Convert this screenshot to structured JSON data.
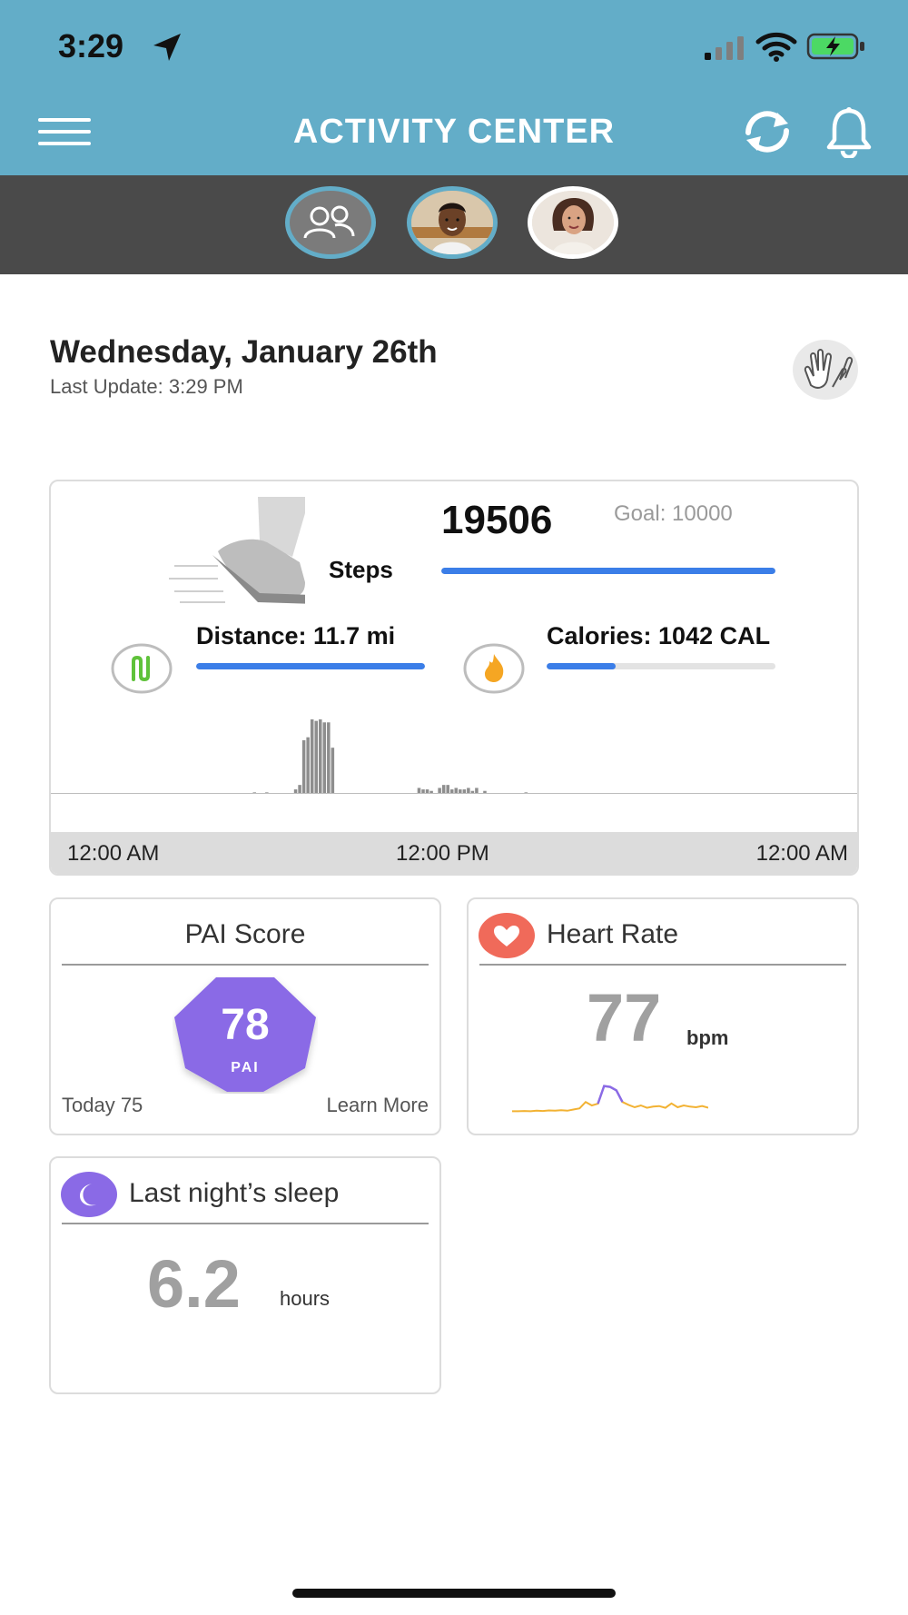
{
  "status_bar": {
    "time": "3:29"
  },
  "header": {
    "title": "ACTIVITY CENTER"
  },
  "profiles": [
    {
      "name": "group",
      "active": true
    },
    {
      "name": "child",
      "active": true
    },
    {
      "name": "adult",
      "active": false
    }
  ],
  "summary": {
    "date": "Wednesday, January 26th",
    "last_update": "Last Update: 3:29 PM"
  },
  "activity": {
    "steps_value": "19506",
    "steps_goal": "Goal: 10000",
    "steps_label": "Steps",
    "steps_progress": 1.0,
    "distance_label": "Distance: 11.7 mi",
    "distance_progress": 1.0,
    "calories_label": "Calories: 1042 CAL",
    "calories_progress": 0.3,
    "axis_labels": [
      "12:00 AM",
      "12:00 PM",
      "12:00 AM"
    ],
    "step_histogram": [
      0,
      0,
      0,
      0,
      0,
      0,
      0,
      0,
      0,
      0,
      0,
      0,
      0,
      0,
      0,
      0,
      0,
      0,
      0,
      0,
      0,
      0,
      0,
      0,
      0,
      0,
      0,
      0,
      0,
      0,
      0,
      0,
      0,
      0,
      0,
      0,
      0,
      0,
      0,
      0,
      0,
      0,
      0,
      0,
      0,
      0,
      0,
      0,
      0,
      2,
      0,
      0,
      2,
      0,
      0,
      0,
      0,
      1,
      0,
      6,
      12,
      72,
      76,
      100,
      98,
      100,
      96,
      96,
      62,
      0,
      0,
      0,
      0,
      0,
      0,
      0,
      0,
      0,
      0,
      0,
      0,
      0,
      0,
      0,
      0,
      0,
      0,
      0,
      0,
      8,
      6,
      6,
      4,
      0,
      8,
      12,
      12,
      6,
      8,
      6,
      6,
      8,
      4,
      8,
      0,
      4,
      0,
      0,
      0,
      0,
      0,
      0,
      0,
      0,
      0,
      2,
      0,
      0,
      0,
      0,
      0,
      0,
      0,
      0,
      0,
      0,
      0,
      0,
      0,
      0,
      0,
      0,
      0,
      0,
      0,
      0,
      0,
      0,
      0,
      0,
      0,
      0,
      0,
      0,
      0,
      0,
      0,
      0,
      0,
      0,
      0,
      0,
      0,
      0,
      0,
      0,
      0,
      0,
      0,
      0,
      0,
      0,
      0,
      0,
      0,
      0,
      0,
      0,
      0,
      0,
      0,
      0,
      0,
      0,
      0,
      0,
      0,
      0,
      0,
      0,
      0,
      0,
      0,
      0,
      0,
      0,
      0,
      0,
      0,
      0,
      0,
      0,
      0,
      0,
      0,
      0
    ]
  },
  "pai": {
    "title": "PAI Score",
    "value": "78",
    "unit": "PAI",
    "today": "Today 75",
    "learn_more": "Learn More"
  },
  "heart_rate": {
    "title": "Heart Rate",
    "value": "77",
    "unit": "bpm",
    "sparkline": [
      8,
      8,
      9,
      8,
      10,
      9,
      11,
      10,
      12,
      10,
      14,
      18,
      40,
      28,
      34,
      95,
      92,
      80,
      40,
      30,
      22,
      28,
      20,
      24,
      26,
      20,
      35,
      22,
      28,
      24,
      22,
      26,
      20
    ]
  },
  "sleep": {
    "title": "Last night’s sleep",
    "value": "6.2",
    "unit": "hours"
  },
  "colors": {
    "header": "#63adc8",
    "profile_bar": "#4a4a4a",
    "accent_blue": "#3b7ee8",
    "pai_purple": "#8a6ae6",
    "heart_red": "#f06a5a"
  }
}
